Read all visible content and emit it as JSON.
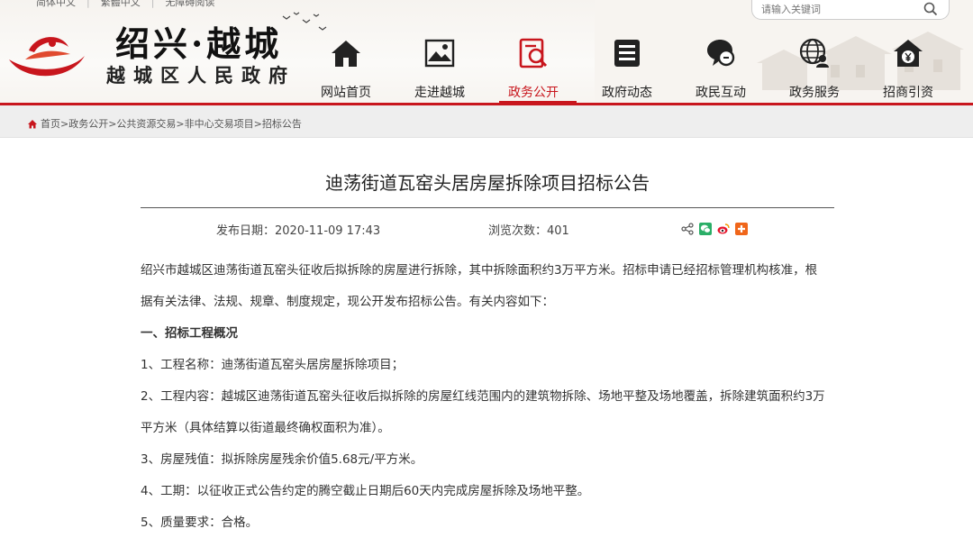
{
  "top_links": [
    "简体中文",
    "繁體中文",
    "无障碍阅读"
  ],
  "logo": {
    "title": "绍兴·越城",
    "subtitle": "越城区人民政府"
  },
  "search": {
    "placeholder": "请输入关键词"
  },
  "nav": [
    {
      "label": "网站首页",
      "icon": "home-icon"
    },
    {
      "label": "走进越城",
      "icon": "picture-icon"
    },
    {
      "label": "政务公开",
      "icon": "document-search-icon",
      "active": true
    },
    {
      "label": "政府动态",
      "icon": "news-icon"
    },
    {
      "label": "政民互动",
      "icon": "chat-icon"
    },
    {
      "label": "政务服务",
      "icon": "globe-user-icon"
    },
    {
      "label": "招商引资",
      "icon": "yen-house-icon"
    }
  ],
  "breadcrumb": {
    "text": "首页>政务公开>公共资源交易>非中心交易项目>招标公告"
  },
  "article": {
    "title": "迪荡街道瓦窑头居房屋拆除项目招标公告",
    "date": "发布日期：2020-11-09 17:43",
    "views": "浏览次数：401",
    "paragraphs": [
      "绍兴市越城区迪荡街道瓦窑头征收后拟拆除的房屋进行拆除，其中拆除面积约3万平方米。招标申请已经招标管理机构核准，根",
      "据有关法律、法规、规章、制度规定，现公开发布招标公告。有关内容如下：",
      "一、招标工程概况",
      "1、工程名称：迪荡街道瓦窑头居房屋拆除项目；",
      "2、工程内容：越城区迪荡街道瓦窑头征收后拟拆除的房屋红线范围内的建筑物拆除、场地平整及场地覆盖，拆除建筑面积约3万",
      "平方米（具体结算以街道最终确权面积为准）。",
      "3、房屋残值：拟拆除房屋残余价值5.68元/平方米。",
      "4、工期：以征收正式公告约定的腾空截止日期后60天内完成房屋拆除及场地平整。",
      "5、质量要求：合格。"
    ]
  },
  "colors": {
    "accent": "#c8161d",
    "breadcrumb_bg": "#eeeeee"
  }
}
